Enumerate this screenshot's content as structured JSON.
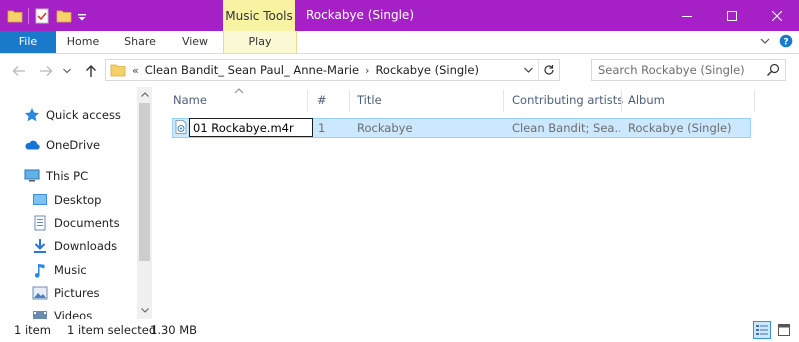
{
  "window": {
    "title": "Rockabye (Single)",
    "context_tab_group": "Music Tools",
    "accent": "#a521c6",
    "minimize_glyph": "–",
    "maximize_glyph": "☐",
    "close_glyph": "✕"
  },
  "ribbon": {
    "tabs": [
      {
        "label": "File"
      },
      {
        "label": "Home"
      },
      {
        "label": "Share"
      },
      {
        "label": "View"
      },
      {
        "label": "Play"
      }
    ]
  },
  "address": {
    "overflow": "«",
    "crumbs": [
      "Clean Bandit_ Sean Paul_ Anne-Marie",
      "Rockabye (Single)"
    ],
    "separator": "›"
  },
  "search": {
    "placeholder": "Search Rockabye (Single)",
    "value": ""
  },
  "nav_pane": {
    "items": [
      {
        "label": "Quick access",
        "icon": "star-icon"
      },
      {
        "label": "OneDrive",
        "icon": "cloud-icon"
      },
      {
        "label": "This PC",
        "icon": "computer-icon"
      },
      {
        "label": "Desktop",
        "icon": "desktop-icon"
      },
      {
        "label": "Documents",
        "icon": "documents-icon"
      },
      {
        "label": "Downloads",
        "icon": "download-icon"
      },
      {
        "label": "Music",
        "icon": "music-icon"
      },
      {
        "label": "Pictures",
        "icon": "pictures-icon"
      },
      {
        "label": "Videos",
        "icon": "videos-icon"
      }
    ]
  },
  "file_list": {
    "columns": [
      "Name",
      "#",
      "Title",
      "Contributing artists",
      "Album"
    ],
    "rows": [
      {
        "name": "01 Rockabye.m4r",
        "number": "1",
        "title": "Rockabye",
        "artists": "Clean Bandit; Sea...",
        "album": "Rockabye (Single)",
        "selected": true,
        "renaming": true
      }
    ]
  },
  "status": {
    "count": "1 item",
    "selection": "1 item selected",
    "size": "1.30 MB"
  }
}
